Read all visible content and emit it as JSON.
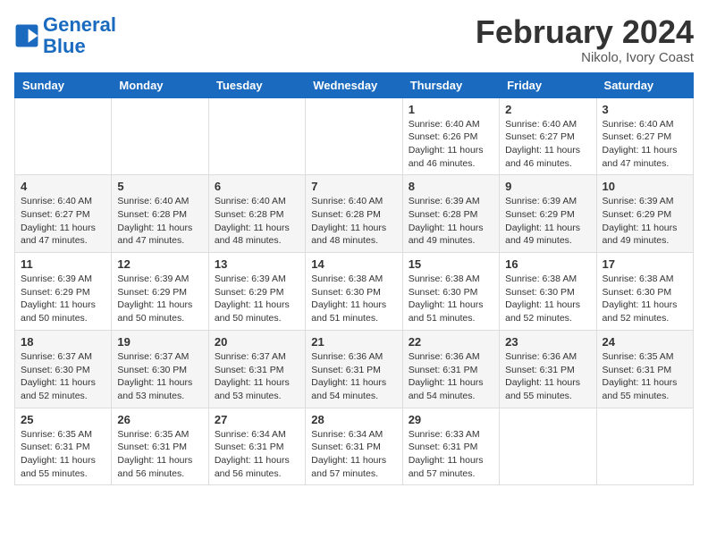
{
  "logo": {
    "line1": "General",
    "line2": "Blue"
  },
  "title": "February 2024",
  "location": "Nikolo, Ivory Coast",
  "days_of_week": [
    "Sunday",
    "Monday",
    "Tuesday",
    "Wednesday",
    "Thursday",
    "Friday",
    "Saturday"
  ],
  "weeks": [
    [
      {
        "day": "",
        "info": ""
      },
      {
        "day": "",
        "info": ""
      },
      {
        "day": "",
        "info": ""
      },
      {
        "day": "",
        "info": ""
      },
      {
        "day": "1",
        "info": "Sunrise: 6:40 AM\nSunset: 6:26 PM\nDaylight: 11 hours\nand 46 minutes."
      },
      {
        "day": "2",
        "info": "Sunrise: 6:40 AM\nSunset: 6:27 PM\nDaylight: 11 hours\nand 46 minutes."
      },
      {
        "day": "3",
        "info": "Sunrise: 6:40 AM\nSunset: 6:27 PM\nDaylight: 11 hours\nand 47 minutes."
      }
    ],
    [
      {
        "day": "4",
        "info": "Sunrise: 6:40 AM\nSunset: 6:27 PM\nDaylight: 11 hours\nand 47 minutes."
      },
      {
        "day": "5",
        "info": "Sunrise: 6:40 AM\nSunset: 6:28 PM\nDaylight: 11 hours\nand 47 minutes."
      },
      {
        "day": "6",
        "info": "Sunrise: 6:40 AM\nSunset: 6:28 PM\nDaylight: 11 hours\nand 48 minutes."
      },
      {
        "day": "7",
        "info": "Sunrise: 6:40 AM\nSunset: 6:28 PM\nDaylight: 11 hours\nand 48 minutes."
      },
      {
        "day": "8",
        "info": "Sunrise: 6:39 AM\nSunset: 6:28 PM\nDaylight: 11 hours\nand 49 minutes."
      },
      {
        "day": "9",
        "info": "Sunrise: 6:39 AM\nSunset: 6:29 PM\nDaylight: 11 hours\nand 49 minutes."
      },
      {
        "day": "10",
        "info": "Sunrise: 6:39 AM\nSunset: 6:29 PM\nDaylight: 11 hours\nand 49 minutes."
      }
    ],
    [
      {
        "day": "11",
        "info": "Sunrise: 6:39 AM\nSunset: 6:29 PM\nDaylight: 11 hours\nand 50 minutes."
      },
      {
        "day": "12",
        "info": "Sunrise: 6:39 AM\nSunset: 6:29 PM\nDaylight: 11 hours\nand 50 minutes."
      },
      {
        "day": "13",
        "info": "Sunrise: 6:39 AM\nSunset: 6:29 PM\nDaylight: 11 hours\nand 50 minutes."
      },
      {
        "day": "14",
        "info": "Sunrise: 6:38 AM\nSunset: 6:30 PM\nDaylight: 11 hours\nand 51 minutes."
      },
      {
        "day": "15",
        "info": "Sunrise: 6:38 AM\nSunset: 6:30 PM\nDaylight: 11 hours\nand 51 minutes."
      },
      {
        "day": "16",
        "info": "Sunrise: 6:38 AM\nSunset: 6:30 PM\nDaylight: 11 hours\nand 52 minutes."
      },
      {
        "day": "17",
        "info": "Sunrise: 6:38 AM\nSunset: 6:30 PM\nDaylight: 11 hours\nand 52 minutes."
      }
    ],
    [
      {
        "day": "18",
        "info": "Sunrise: 6:37 AM\nSunset: 6:30 PM\nDaylight: 11 hours\nand 52 minutes."
      },
      {
        "day": "19",
        "info": "Sunrise: 6:37 AM\nSunset: 6:30 PM\nDaylight: 11 hours\nand 53 minutes."
      },
      {
        "day": "20",
        "info": "Sunrise: 6:37 AM\nSunset: 6:31 PM\nDaylight: 11 hours\nand 53 minutes."
      },
      {
        "day": "21",
        "info": "Sunrise: 6:36 AM\nSunset: 6:31 PM\nDaylight: 11 hours\nand 54 minutes."
      },
      {
        "day": "22",
        "info": "Sunrise: 6:36 AM\nSunset: 6:31 PM\nDaylight: 11 hours\nand 54 minutes."
      },
      {
        "day": "23",
        "info": "Sunrise: 6:36 AM\nSunset: 6:31 PM\nDaylight: 11 hours\nand 55 minutes."
      },
      {
        "day": "24",
        "info": "Sunrise: 6:35 AM\nSunset: 6:31 PM\nDaylight: 11 hours\nand 55 minutes."
      }
    ],
    [
      {
        "day": "25",
        "info": "Sunrise: 6:35 AM\nSunset: 6:31 PM\nDaylight: 11 hours\nand 55 minutes."
      },
      {
        "day": "26",
        "info": "Sunrise: 6:35 AM\nSunset: 6:31 PM\nDaylight: 11 hours\nand 56 minutes."
      },
      {
        "day": "27",
        "info": "Sunrise: 6:34 AM\nSunset: 6:31 PM\nDaylight: 11 hours\nand 56 minutes."
      },
      {
        "day": "28",
        "info": "Sunrise: 6:34 AM\nSunset: 6:31 PM\nDaylight: 11 hours\nand 57 minutes."
      },
      {
        "day": "29",
        "info": "Sunrise: 6:33 AM\nSunset: 6:31 PM\nDaylight: 11 hours\nand 57 minutes."
      },
      {
        "day": "",
        "info": ""
      },
      {
        "day": "",
        "info": ""
      }
    ]
  ]
}
